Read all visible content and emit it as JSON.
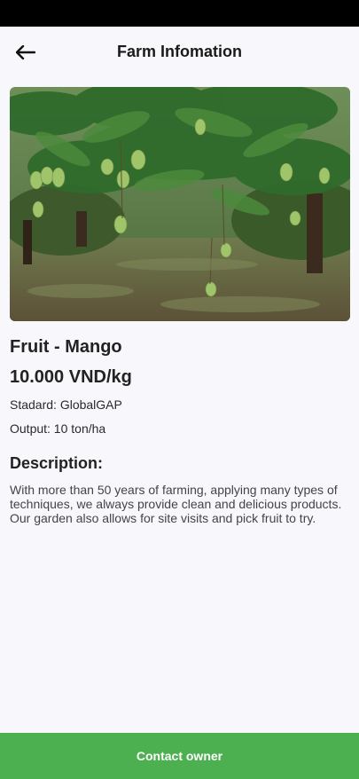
{
  "header": {
    "title": "Farm Infomation",
    "back_icon": "arrow-left-icon"
  },
  "colors": {
    "accent": "#4caf50",
    "background": "#f8f8fc",
    "status_bar": "#000000"
  },
  "farm": {
    "image": "mango-tree-photo",
    "fruit": "Fruit - Mango",
    "price": "10.000 VND/kg",
    "standard": "Stadard: GlobalGAP",
    "output": "Output: 10 ton/ha"
  },
  "description": {
    "heading": "Description:",
    "body": "With more than 50 years of farming, applying many types of techniques, we always provide clean and delicious products. Our garden also allows for site visits and pick fruit to try."
  },
  "actions": {
    "contact_label": "Contact owner"
  }
}
